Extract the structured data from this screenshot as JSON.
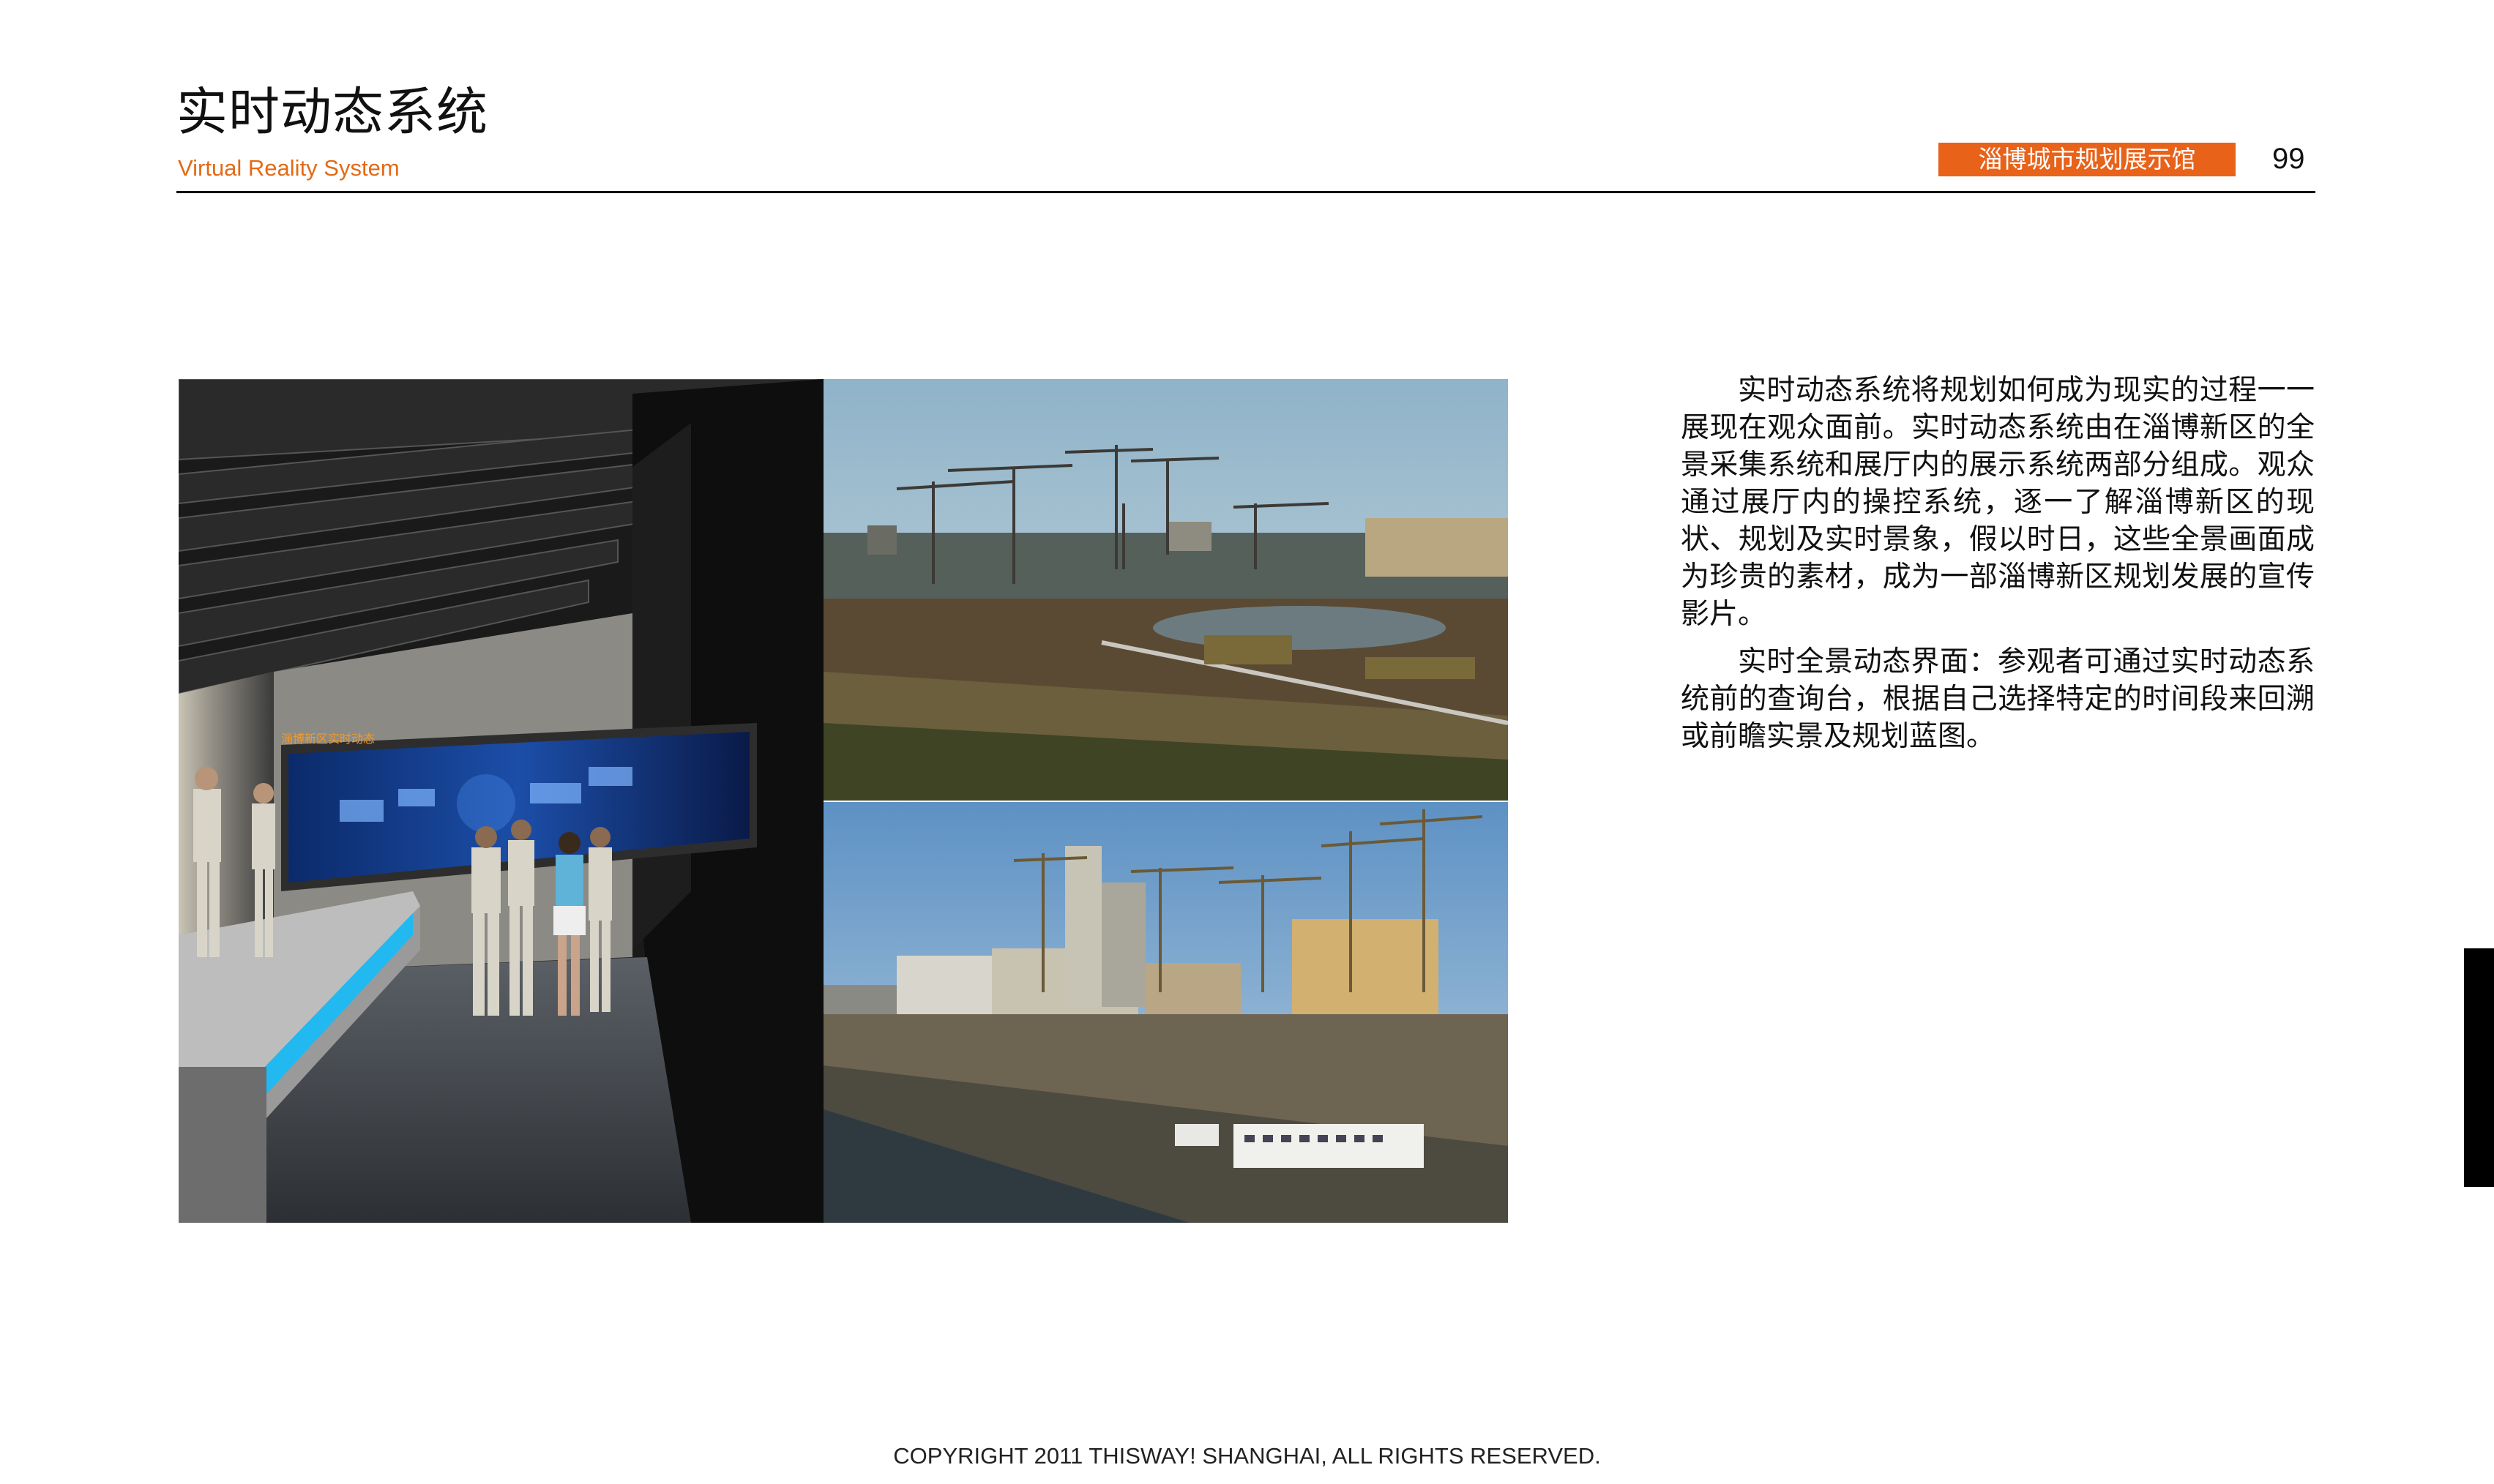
{
  "header": {
    "title": "实时动态系统",
    "subtitle": "Virtual Reality System",
    "badge": "淄博城市规划展示馆",
    "page_number": "99"
  },
  "photos": {
    "hall_screen_caption": "淄博新区实时动态"
  },
  "body": {
    "paragraphs": [
      "实时动态系统将规划如何成为现实的过程一一展现在观众面前。实时动态系统由在淄博新区的全景采集系统和展厅内的展示系统两部分组成。观众通过展厅内的操控系统，逐一了解淄博新区的现状、规划及实时景象，假以时日，这些全景画面成为珍贵的素材，成为一部淄博新区规划发展的宣传影片。",
      "实时全景动态界面：参观者可通过实时动态系统前的查询台，根据自己选择特定的时间段来回溯或前瞻实景及规划蓝图。"
    ]
  },
  "footer": {
    "copyright": "COPYRIGHT 2011 THISWAY! SHANGHAI, ALL RIGHTS RESERVED."
  },
  "colors": {
    "accent": "#e8621a",
    "subtitle": "#e36a16",
    "rule": "#111111"
  }
}
